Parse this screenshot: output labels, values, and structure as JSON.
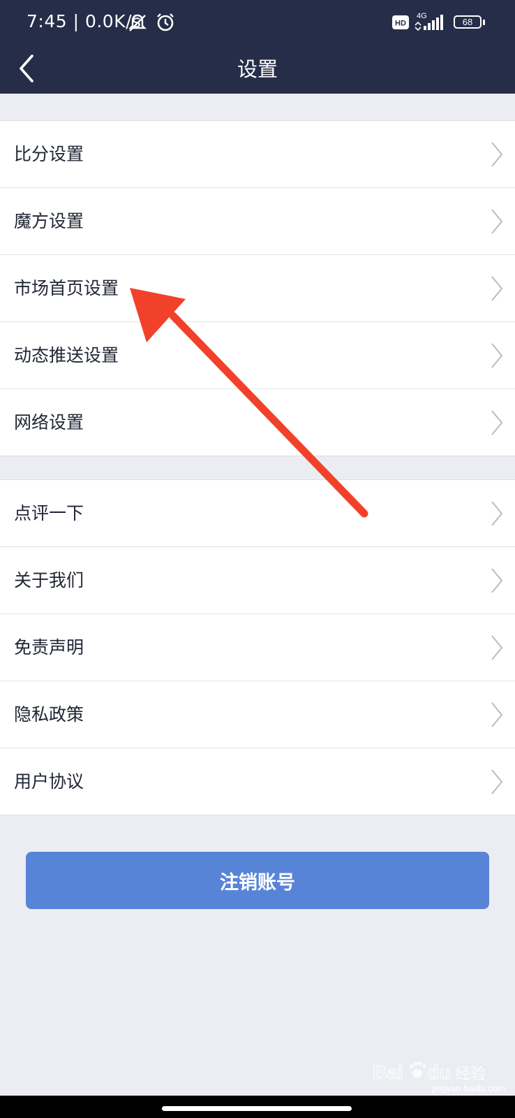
{
  "status": {
    "time": "7:45 | 0.0K/s",
    "network": "4G",
    "battery": "68",
    "icons": [
      "mute-bell-icon",
      "alarm-icon",
      "hd-icon",
      "signal-icon",
      "battery-icon"
    ]
  },
  "header": {
    "title": "设置",
    "back_icon": "back-chevron-icon"
  },
  "groups": [
    {
      "items": [
        {
          "label": "比分设置"
        },
        {
          "label": "魔方设置"
        },
        {
          "label": "市场首页设置"
        },
        {
          "label": "动态推送设置"
        },
        {
          "label": "网络设置"
        }
      ]
    },
    {
      "items": [
        {
          "label": "点评一下"
        },
        {
          "label": "关于我们"
        },
        {
          "label": "免责声明"
        },
        {
          "label": "隐私政策"
        },
        {
          "label": "用户协议"
        }
      ]
    }
  ],
  "logout_button": {
    "label": "注销账号"
  },
  "watermark": {
    "brand": "Baidu 经验",
    "url": "jingyan.baidu.com"
  },
  "colors": {
    "header_bg": "#252d48",
    "page_bg": "#ebedf2",
    "button_bg": "#5884d8",
    "annotation_arrow": "#f2412a"
  }
}
